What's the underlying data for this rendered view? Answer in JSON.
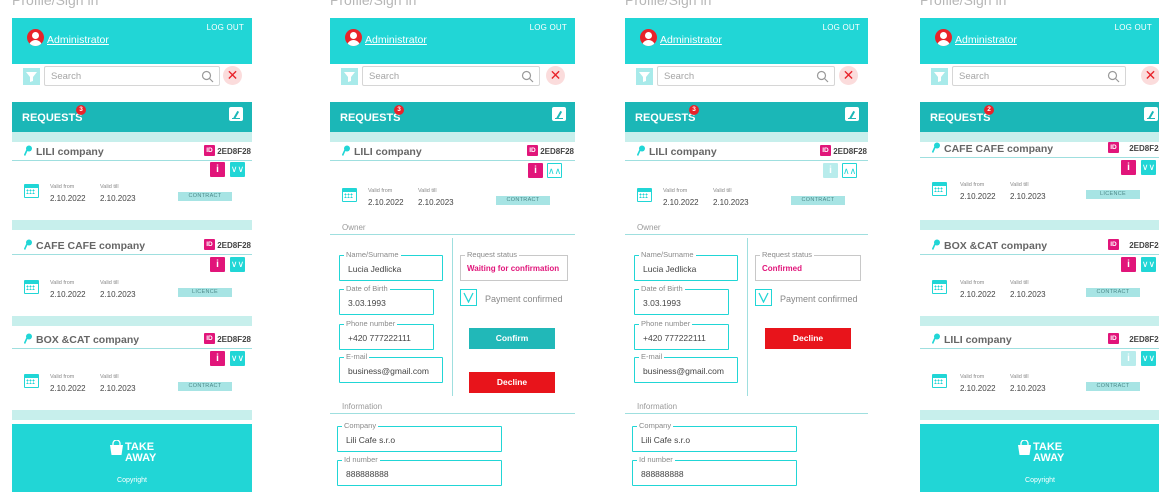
{
  "frame_title": "Profile/Sign in",
  "app": {
    "logout": "LOG OUT",
    "user": "Administrator",
    "search_placeholder": "Search",
    "clear": "✕",
    "requests_label": "REQUESTS",
    "requests_badges": [
      "3",
      "3",
      "3",
      "2"
    ],
    "info": "i",
    "id_badge": "ID",
    "id_code": "2ED8F28",
    "valid_from_label": "Valid from",
    "valid_till_label": "Valid till",
    "valid_from": "2.10.2022",
    "valid_till": "2.10.2023",
    "take_away": [
      "TAKE",
      "AWAY"
    ],
    "copyright": "Copyright",
    "colors": {
      "accent": "#21d6d6",
      "accent_dark": "#1bb7b7",
      "pink": "#e1157a",
      "red": "#e8141b"
    }
  },
  "screen1": {
    "cards": [
      {
        "company": "LILI company",
        "type": "CONTRACT"
      },
      {
        "company": "CAFE CAFE company",
        "type": "LICENCE"
      },
      {
        "company": "BOX &CAT company",
        "type": "CONTRACT"
      }
    ]
  },
  "screen4": {
    "cards": [
      {
        "company": "CAFE CAFE company",
        "type": "LICENCE"
      },
      {
        "company": "BOX &CAT company",
        "type": "CONTRACT"
      },
      {
        "company": "LILI company",
        "type": "CONTRACT"
      }
    ]
  },
  "detail": {
    "company": "LILI company",
    "type": "CONTRACT",
    "owner_label": "Owner",
    "information_label": "Information",
    "name_label": "Name/Surname",
    "name": "Lucia Jedlicka",
    "dob_label": "Date of Birth",
    "dob": "3.03.1993",
    "phone_label": "Phone number",
    "phone": "+420 777222111",
    "email_label": "E-mail",
    "email": "business@gmail.com",
    "status_label": "Request status",
    "payment_label": "Payment confirmed",
    "company_label": "Company",
    "company_name": "Lili Cafe s.r.o",
    "id_label": "Id number",
    "id_number": "888888888",
    "confirm": "Confirm",
    "decline": "Decline"
  },
  "screen2": {
    "status": "Waiting for confirmation"
  },
  "screen3": {
    "status": "Confirmed"
  }
}
